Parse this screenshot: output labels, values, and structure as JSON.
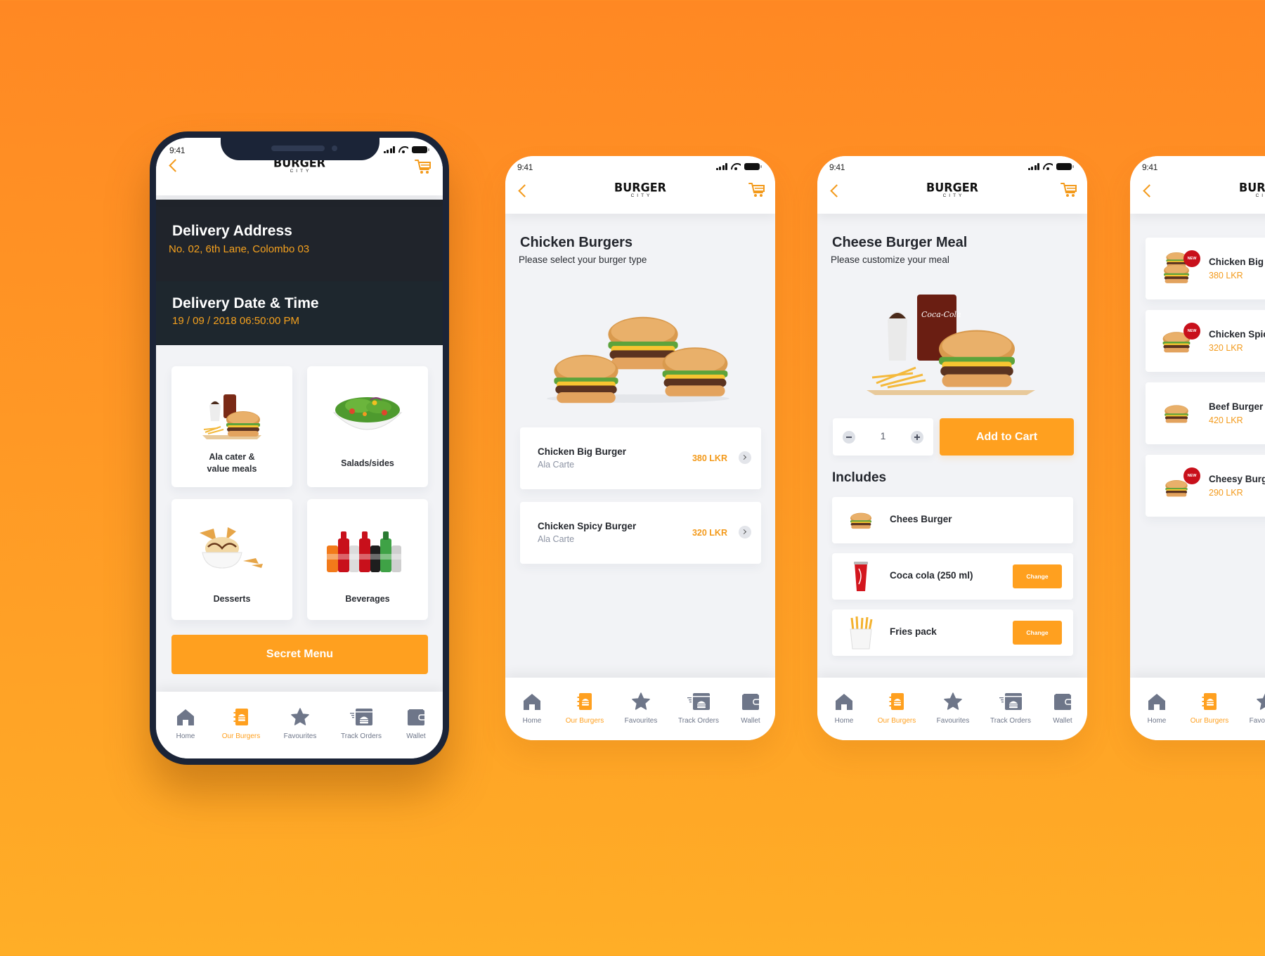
{
  "colors": {
    "accent": "#FFA01F",
    "price": "#F39A1B",
    "dark_panel": "#20242B",
    "nav_inactive": "#6E7689",
    "new_badge": "#C8101B"
  },
  "status_bar": {
    "time": "9:41"
  },
  "brand": {
    "line1": "BURGER",
    "line2": "CITY"
  },
  "nav": [
    {
      "label": "Home",
      "icon": "home-icon"
    },
    {
      "label": "Our Burgers",
      "icon": "burger-menu-book-icon",
      "active": true
    },
    {
      "label": "Favourites",
      "icon": "star-icon"
    },
    {
      "label": "Track Orders",
      "icon": "track-orders-icon"
    },
    {
      "label": "Wallet",
      "icon": "wallet-icon"
    }
  ],
  "screen1": {
    "delivery_address": {
      "title": "Delivery Address",
      "value": "No. 02, 6th Lane, Colombo 03"
    },
    "delivery_datetime": {
      "title": "Delivery Date & Time",
      "value": "19 / 09 / 2018  06:50:00 PM"
    },
    "categories": [
      {
        "label_line1": "Ala cater &",
        "label_line2": "value meals",
        "image": "meal-image"
      },
      {
        "label_line1": "Salads/sides",
        "label_line2": "",
        "image": "salad-image"
      },
      {
        "label_line1": "Desserts",
        "label_line2": "",
        "image": "dessert-image"
      },
      {
        "label_line1": "Beverages",
        "label_line2": "",
        "image": "beverages-image"
      }
    ],
    "secret_menu_label": "Secret Menu"
  },
  "screen2": {
    "title": "Chicken Burgers",
    "subtitle": "Please select your burger type",
    "items": [
      {
        "name": "Chicken Big Burger",
        "sub": "Ala Carte",
        "price": "380 LKR"
      },
      {
        "name": "Chicken Spicy Burger",
        "sub": "Ala Carte",
        "price": "320 LKR"
      }
    ]
  },
  "screen3": {
    "title": "Cheese Burger Meal",
    "subtitle": "Please customize your meal",
    "quantity": "1",
    "add_to_cart_label": "Add to Cart",
    "includes_title": "Includes",
    "includes": [
      {
        "name": "Chees Burger",
        "change_label": ""
      },
      {
        "name": "Coca cola (250 ml)",
        "change_label": "Change"
      },
      {
        "name": "Fries pack",
        "change_label": "Change"
      }
    ]
  },
  "screen4": {
    "items": [
      {
        "name": "Chicken Big Burger",
        "price": "380 LKR",
        "badge": "NEW"
      },
      {
        "name": "Chicken Spicy Burger",
        "price": "320 LKR",
        "badge": "NEW"
      },
      {
        "name": "Beef Burger",
        "price": "420 LKR",
        "badge": ""
      },
      {
        "name": "Cheesy Burger",
        "price": "290 LKR",
        "badge": "NEW"
      }
    ]
  }
}
